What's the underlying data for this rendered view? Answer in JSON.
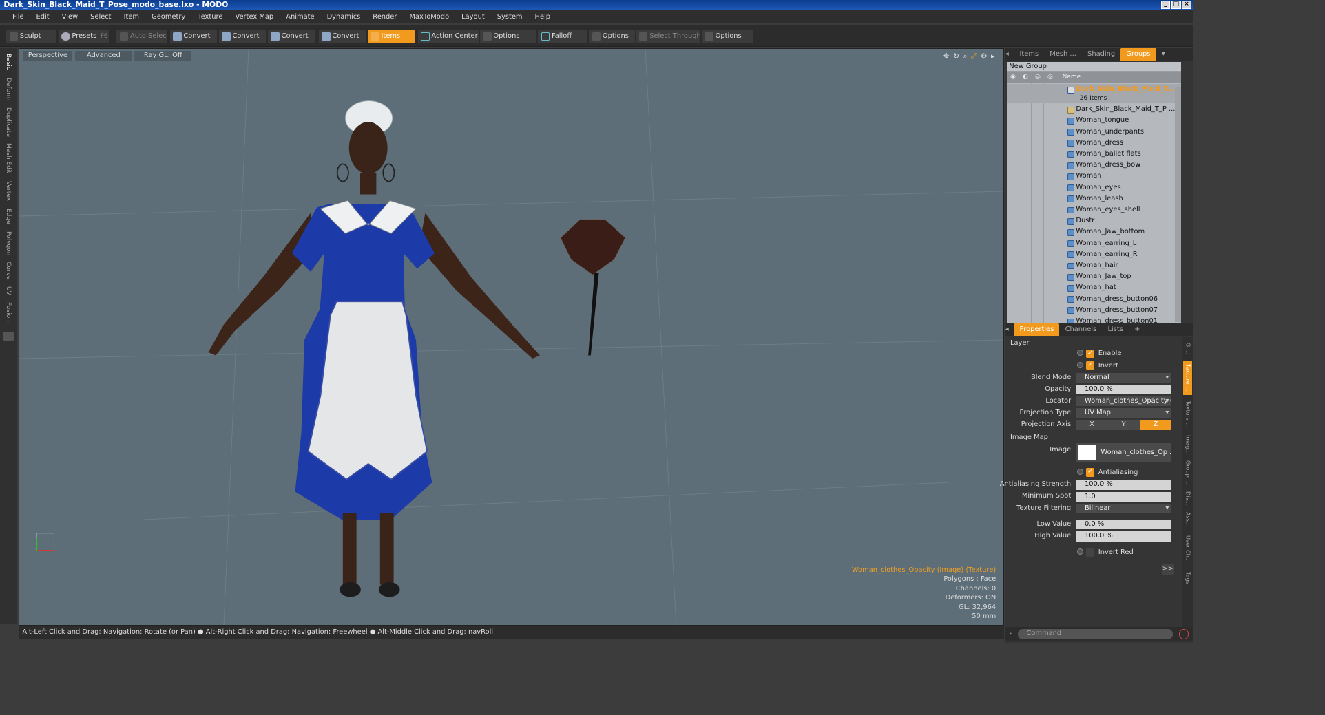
{
  "window": {
    "title": "Dark_Skin_Black_Maid_T_Pose_modo_base.lxo - MODO"
  },
  "menu": [
    "File",
    "Edit",
    "View",
    "Select",
    "Item",
    "Geometry",
    "Texture",
    "Vertex Map",
    "Animate",
    "Dynamics",
    "Render",
    "MaxToModo",
    "Layout",
    "System",
    "Help"
  ],
  "toolbar": {
    "sculpt": "Sculpt",
    "presets": "Presets",
    "presets_key": "F6",
    "auto_select": "Auto Select",
    "convert1": "Convert",
    "convert2": "Convert",
    "convert3": "Convert",
    "convert4": "Convert",
    "items": "Items",
    "action_center": "Action Center",
    "options1": "Options",
    "falloff": "Falloff",
    "options2": "Options",
    "select_through": "Select Through",
    "options3": "Options"
  },
  "left_tabs": [
    "Basic",
    "Deform",
    "Duplicate",
    "Mesh Edit",
    "Vertex",
    "Edge",
    "Polygon",
    "Curve",
    "UV",
    "Fusion"
  ],
  "viewport": {
    "view_mode": "Perspective",
    "advanced": "Advanced",
    "ray_gl": "Ray GL: Off",
    "hud": {
      "selection": "Woman_clothes_Opacity (Image) (Texture)",
      "polygons": "Polygons : Face",
      "channels": "Channels: 0",
      "deformers": "Deformers: ON",
      "gl": "GL: 32,964",
      "scale": "50 mm"
    }
  },
  "status": "Alt-Left Click and Drag: Navigation: Rotate (or Pan) ● Alt-Right Click and Drag: Navigation: Freewheel ● Alt-Middle Click and Drag: navRoll",
  "panel_tabs": [
    "Items",
    "Mesh ...",
    "Shading",
    "Groups"
  ],
  "groups": {
    "new_group": "New Group",
    "col_name": "Name",
    "root": "Dark_Skin_Black_Maid_T...",
    "root_count": "26 Items",
    "items": [
      "Dark_Skin_Black_Maid_T_P ...",
      "Woman_tongue",
      "Woman_underpants",
      "Woman_dress",
      "Woman_ballet flats",
      "Woman_dress_bow",
      "Woman",
      "Woman_eyes",
      "Woman_leash",
      "Woman_eyes_shell",
      "Dustr",
      "Woman_Jaw_bottom",
      "Woman_earring_L",
      "Woman_earring_R",
      "Woman_hair",
      "Woman_Jaw_top",
      "Woman_hat",
      "Woman_dress_button06",
      "Woman_dress_button07",
      "Woman_dress_button01"
    ]
  },
  "prop_tabs": [
    "Properties",
    "Channels",
    "Lists",
    "+"
  ],
  "properties": {
    "layer": "Layer",
    "enable": "Enable",
    "invert": "Invert",
    "blend_mode_label": "Blend Mode",
    "blend_mode": "Normal",
    "opacity_label": "Opacity",
    "opacity": "100.0 %",
    "locator_label": "Locator",
    "locator": "Woman_clothes_Opacity (Im...",
    "projection_type_label": "Projection Type",
    "projection_type": "UV Map",
    "projection_axis_label": "Projection Axis",
    "axis_x": "X",
    "axis_y": "Y",
    "axis_z": "Z",
    "image_map": "Image Map",
    "image_label": "Image",
    "image": "Woman_clothes_Op ...",
    "antialiasing": "Antialiasing",
    "aa_strength_label": "Antialiasing Strength",
    "aa_strength": "100.0 %",
    "min_spot_label": "Minimum Spot",
    "min_spot": "1.0",
    "tex_filter_label": "Texture Filtering",
    "tex_filter": "Bilinear",
    "low_label": "Low Value",
    "low": "0.0 %",
    "high_label": "High Value",
    "high": "100.0 %",
    "invert_red": "Invert Red",
    "expand": ">>"
  },
  "side_tabs": [
    "Gr...",
    "Texture ...",
    "Texture ...",
    "Imag...",
    "Group ...",
    "Dis...",
    "Ass...",
    "User Ch...",
    "Tags"
  ],
  "command": "Command",
  "colors": {
    "accent": "#f29a1e",
    "viewport_bg": "#5d6e78",
    "dress": "#1c3aa8"
  }
}
